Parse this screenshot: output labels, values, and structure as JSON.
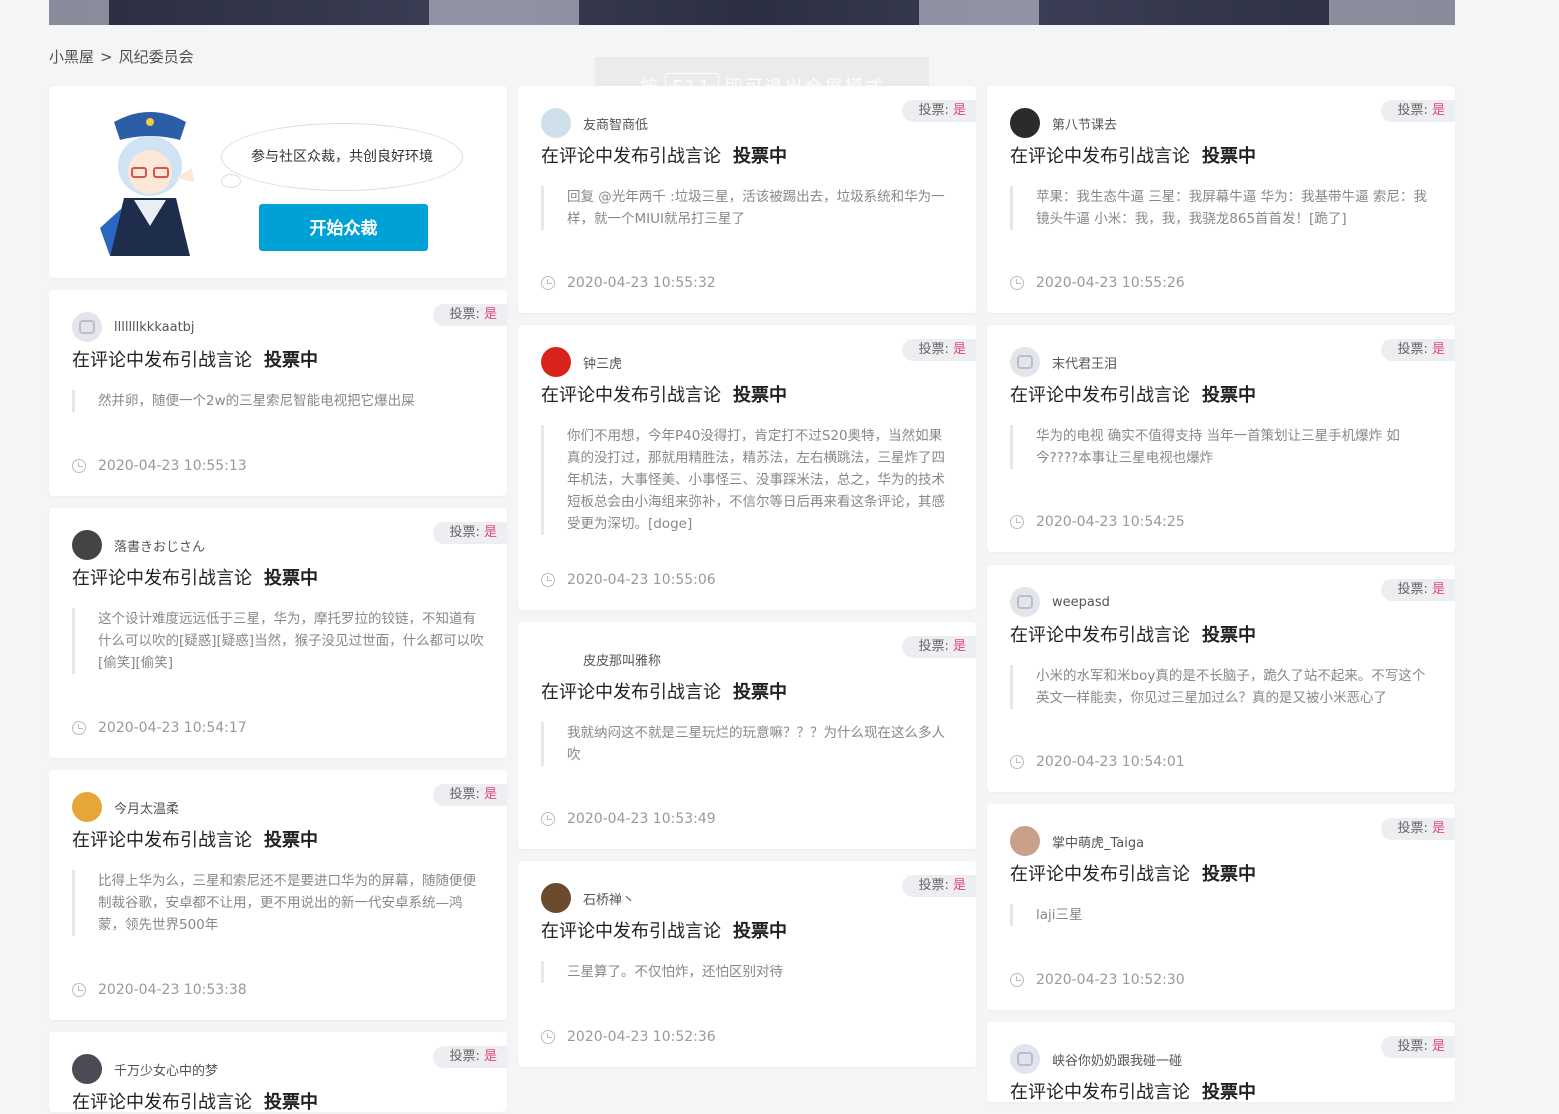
{
  "breadcrumb": {
    "home": "小黑屋",
    "sep": ">",
    "current": "风纪委员会"
  },
  "fullscreen_hint": {
    "pre": "按",
    "key": "F11",
    "post": "即可退出全屏模式"
  },
  "intro": {
    "bubble_text": "参与社区众裁，共创良好环境",
    "button_label": "开始众裁"
  },
  "vote_prefix": "投票:",
  "vote_value": "是",
  "title_main": "在评论中发布引战言论",
  "title_status": "投票中",
  "cards": [
    {
      "user": "lllllllkkkaatbj",
      "content": "然并卵，随便一个2w的三星索尼智能电视把它爆出屎",
      "time": "2020-04-23 10:55:13"
    },
    {
      "user": "落書きおじさん",
      "content": "这个设计难度远远低于三星，华为，摩托罗拉的铰链，不知道有什么可以吹的[疑惑][疑惑]当然，猴子没见过世面，什么都可以吹[偷笑][偷笑]",
      "time": "2020-04-23 10:54:17"
    },
    {
      "user": "今月太温柔",
      "content": "比得上华为么，三星和索尼还不是要进口华为的屏幕，随随便便制裁谷歌，安卓都不让用，更不用说出的新一代安卓系统—鸿蒙，领先世界500年",
      "time": "2020-04-23 10:53:38"
    },
    {
      "user": "千万少女心中的梦",
      "content": "",
      "time": ""
    },
    {
      "user": "友商智商低",
      "content": "回复 @光年两千 :垃圾三星，活该被踢出去，垃圾系统和华为一样，就一个MIUI就吊打三星了",
      "time": "2020-04-23 10:55:32"
    },
    {
      "user": "钟三虎",
      "content": "你们不用想，今年P40没得打，肯定打不过S20奥特，当然如果真的没打过，那就用精胜法，精苏法，左右横跳法，三星炸了四年机法，大事怪美、小事怪三、没事踩米法，总之，华为的技术短板总会由小海组来弥补，不信尔等日后再来看这条评论，其感受更为深切。[doge]",
      "time": "2020-04-23 10:55:06"
    },
    {
      "user": "皮皮那叫雅称",
      "content": "我就纳闷这不就是三星玩烂的玩意嘛？？？为什么现在这么多人吹",
      "time": "2020-04-23 10:53:49"
    },
    {
      "user": "石桥禅丶",
      "content": "三星算了。不仅怕炸，还怕区别对待",
      "time": "2020-04-23 10:52:36"
    },
    {
      "user": "第八节课去",
      "content": "苹果：我生态牛逼 三星：我屏幕牛逼 华为：我基带牛逼 索尼：我镜头牛逼 小米：我，我，我骁龙865首首发！[跪了]",
      "time": "2020-04-23 10:55:26"
    },
    {
      "user": "末代君王泪",
      "content": "华为的电视 确实不值得支持 当年一首策划让三星手机爆炸 如今????本事让三星电视也爆炸",
      "time": "2020-04-23 10:54:25"
    },
    {
      "user": "weepasd",
      "content": "小米的水军和米boy真的是不长脑子，跪久了站不起来。不写这个英文一样能卖，你见过三星加过么？真的是又被小米恶心了",
      "time": "2020-04-23 10:54:01"
    },
    {
      "user": "掌中萌虎_Taiga",
      "content": "laji三星",
      "time": "2020-04-23 10:52:30"
    },
    {
      "user": "峡谷你奶奶跟我碰一碰",
      "content": "",
      "time": ""
    }
  ]
}
